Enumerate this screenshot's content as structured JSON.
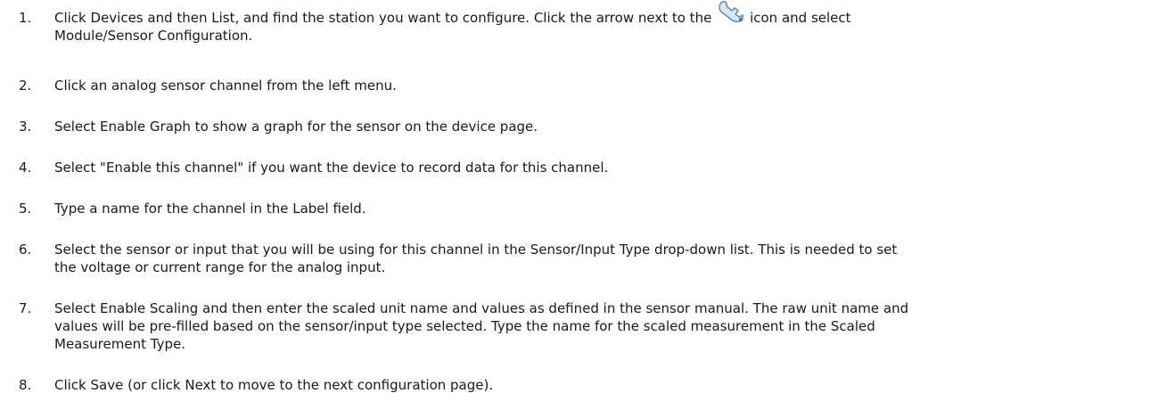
{
  "steps": [
    {
      "number": "1.",
      "lines": [
        {
          "before": "Click Devices and then List, and find the station you want to configure. Click the arrow next to the",
          "icon": "wrench-icon",
          "after": "icon and select"
        },
        {
          "text": "Module/Sensor Configuration."
        }
      ]
    },
    {
      "number": "2.",
      "lines": [
        {
          "text": "Click an analog sensor channel from the left menu."
        }
      ]
    },
    {
      "number": "3.",
      "lines": [
        {
          "text": "Select Enable Graph to show a graph for the sensor on the device page."
        }
      ]
    },
    {
      "number": "4.",
      "lines": [
        {
          "text": "Select \"Enable this channel\" if you want the device to record data for this channel."
        }
      ]
    },
    {
      "number": "5.",
      "lines": [
        {
          "text": "Type a name for the channel in the Label field."
        }
      ]
    },
    {
      "number": "6.",
      "lines": [
        {
          "text": "Select the sensor or input that you will be using for this channel in the Sensor/Input Type drop-down list. This is needed to set"
        },
        {
          "text": "the voltage or current range for the analog input."
        }
      ]
    },
    {
      "number": "7.",
      "lines": [
        {
          "text": "Select Enable Scaling and then enter the scaled unit name and values as defined in the sensor manual. The raw unit name and"
        },
        {
          "text": "values will be pre-filled based on the sensor/input type selected. Type the name for the scaled measurement in the Scaled"
        },
        {
          "text": "Measurement Type."
        }
      ]
    },
    {
      "number": "8.",
      "lines": [
        {
          "text": "Click Save (or click Next to move to the next configuration page)."
        }
      ]
    }
  ],
  "colors": {
    "text": "#1a1a1a",
    "icon_outline": "#6a8fb5",
    "icon_fill": "#dbe7f3"
  }
}
